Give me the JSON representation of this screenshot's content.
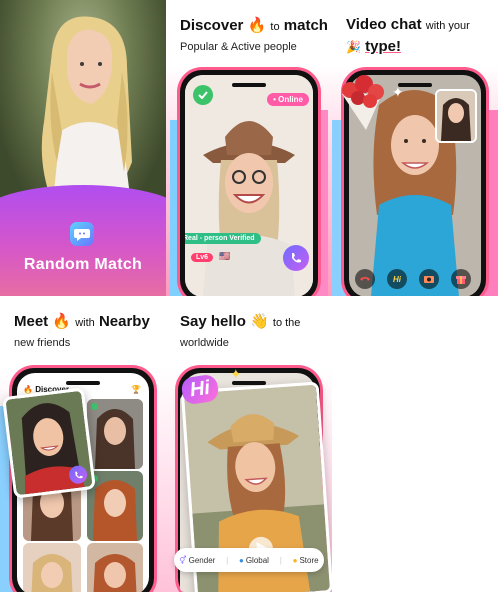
{
  "panel_random_match": {
    "title": "Random Match",
    "icon": "chat-bubble-icon"
  },
  "panel_discover": {
    "heading_word1": "Discover",
    "heading_emoji": "🔥",
    "heading_word2": "to",
    "heading_word3": "match",
    "subtitle": "Popular & Active people",
    "online_badge": "• Online",
    "verified_badge": "Real - person Verified",
    "level_badge": "Lv6",
    "flag": "🇺🇸"
  },
  "panel_video_chat": {
    "heading": "Video chat",
    "heading_small": "with your",
    "emoji": "🎉",
    "type_word": "type!",
    "bottom_icons": [
      "phone-hangup-icon",
      "hi-icon",
      "camera-flip-icon",
      "gift-icon"
    ],
    "hi_label": "Hi"
  },
  "panel_nearby": {
    "heading_word1": "Meet",
    "heading_emoji": "🔥",
    "heading_small": "with",
    "heading_word2": "Nearby",
    "subtitle": "new friends",
    "screen_title": "Discover"
  },
  "panel_say_hello": {
    "heading": "Say hello",
    "emoji": "👋",
    "heading_small": "to the",
    "subtitle": "worldwide",
    "hi_sticker": "Hi",
    "nav_items": [
      {
        "label": "Gender",
        "icon": "gender-icon"
      },
      {
        "label": "Global",
        "icon": "globe-icon"
      },
      {
        "label": "Store",
        "icon": "coin-icon"
      }
    ]
  },
  "colors": {
    "accent_pink": "#ff5b8c",
    "accent_purple": "#b04df0",
    "online_green": "#3cc36a"
  }
}
